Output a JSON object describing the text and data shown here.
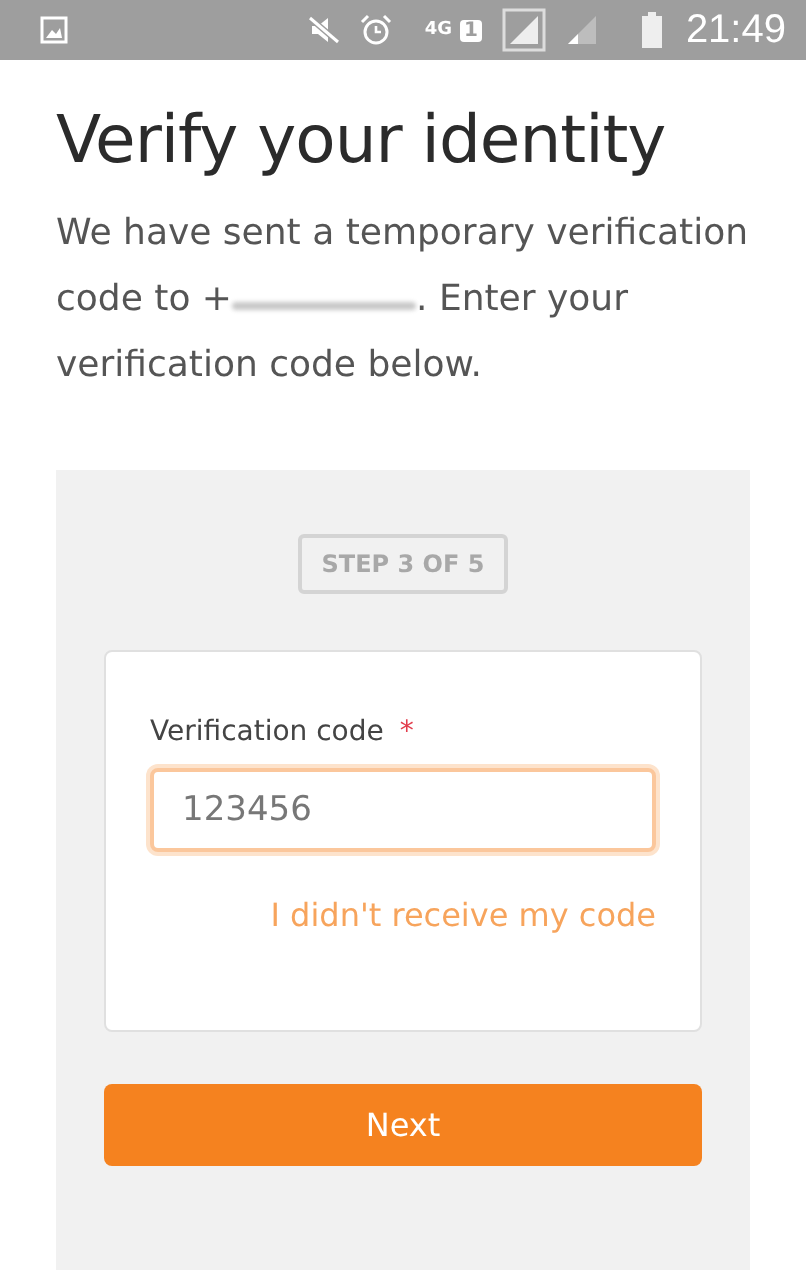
{
  "status_bar": {
    "time": "21:49",
    "network": "4G",
    "sim": "1"
  },
  "title": "Verify your identity",
  "intro": {
    "before": "We have sent a temporary verification code to +",
    "redacted": true,
    "after": ". Enter your verification code below."
  },
  "step": "STEP 3 OF 5",
  "form": {
    "label": "Verification code",
    "required": true,
    "required_mark": "*",
    "placeholder": "123456",
    "focused": true
  },
  "link": "I didn't receive my code",
  "next_button": "Next"
}
